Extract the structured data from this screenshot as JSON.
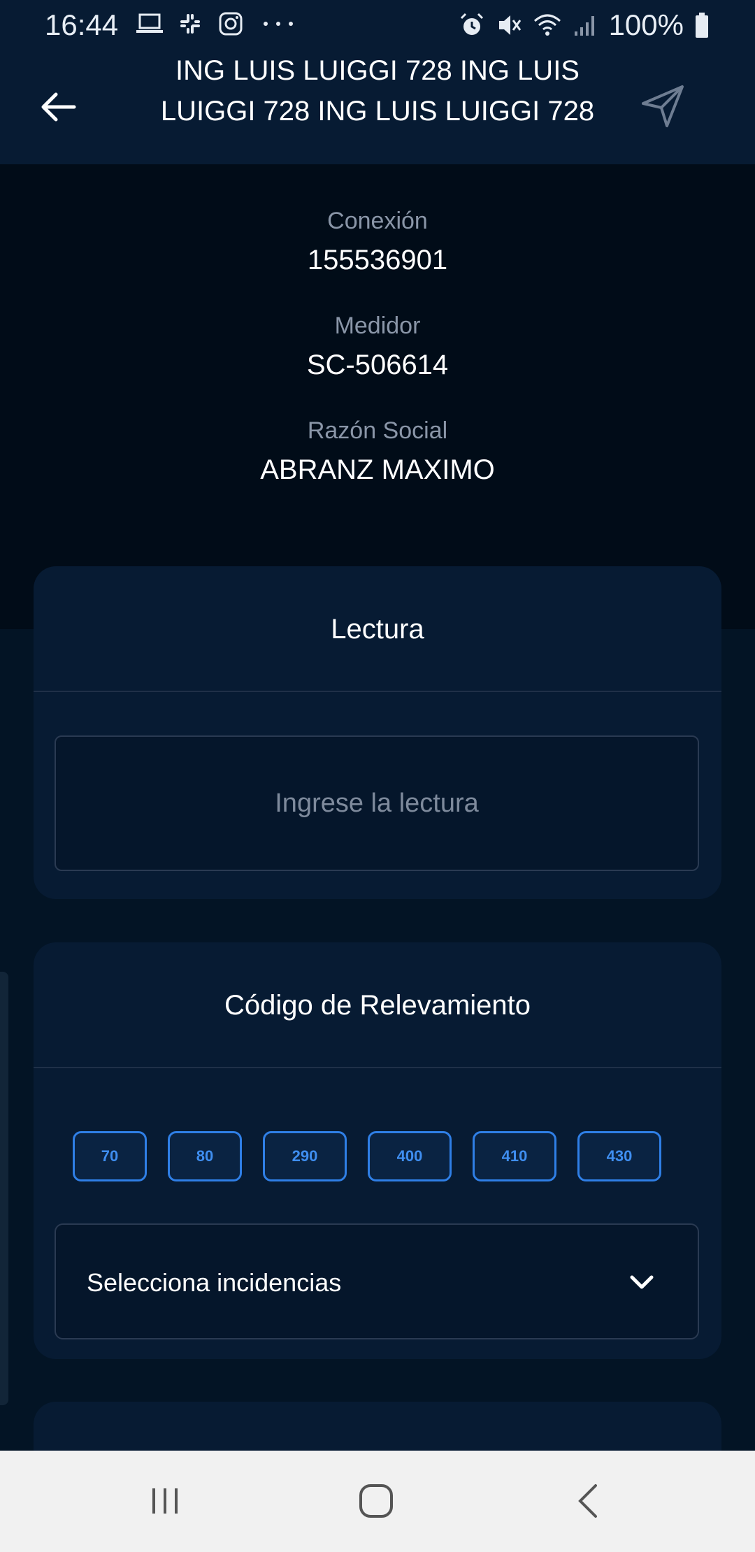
{
  "status_bar": {
    "time": "16:44",
    "left_icons": [
      "laptop-icon",
      "slack-icon",
      "instagram-icon",
      "more-dots-icon"
    ],
    "right_icons": [
      "alarm-icon",
      "mute-icon",
      "wifi-icon",
      "signal-icon",
      "battery-icon"
    ],
    "battery": "100%"
  },
  "header": {
    "title": "ING LUIS LUIGGI 728  ING LUIS LUIGGI 728  ING LUIS LUIGGI 728",
    "back_icon": "arrow-left-icon",
    "send_icon": "send-icon"
  },
  "info": {
    "conexion_label": "Conexión",
    "conexion_value": "155536901",
    "medidor_label": "Medidor",
    "medidor_value": "SC-506614",
    "razon_label": "Razón Social",
    "razon_value": "ABRANZ MAXIMO"
  },
  "lectura": {
    "title": "Lectura",
    "placeholder": "Ingrese la lectura"
  },
  "codigo": {
    "title": "Código de Relevamiento",
    "chips": [
      "70",
      "80",
      "290",
      "400",
      "410",
      "430"
    ],
    "select_label": "Selecciona incidencias"
  },
  "colors": {
    "accent": "#2f7fe6",
    "header_bg": "#071b33",
    "card_bg": "#071b33",
    "nav_bg": "#f1f1f1"
  }
}
